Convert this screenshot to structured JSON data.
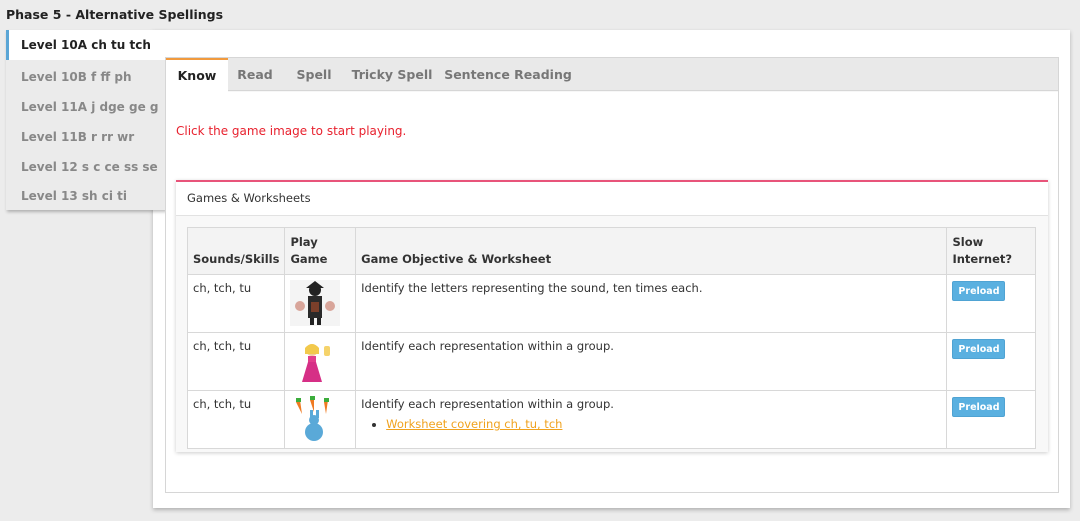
{
  "phase_title": "Phase 5 - Alternative Spellings",
  "levels": [
    {
      "label": "Level 10A ch tu tch",
      "active": true
    },
    {
      "label": "Level 10B f ff ph",
      "active": false
    },
    {
      "label": "Level 11A j dge ge g",
      "active": false
    },
    {
      "label": "Level 11B r rr wr",
      "active": false
    },
    {
      "label": "Level 12 s c ce ss se",
      "active": false
    },
    {
      "label": "Level 13 sh ci ti",
      "active": false
    }
  ],
  "tabs": [
    {
      "label": "Know",
      "active": true
    },
    {
      "label": "Read",
      "active": false
    },
    {
      "label": "Spell",
      "active": false
    },
    {
      "label": "Tricky Spell",
      "active": false
    },
    {
      "label": "Sentence Reading",
      "active": false
    }
  ],
  "instruction": "Click the game image to start playing.",
  "games_panel": {
    "title": "Games & Worksheets",
    "columns": {
      "sounds": "Sounds/Skills",
      "play": "Play Game",
      "objective": "Game Objective & Worksheet",
      "slow": "Slow Internet?"
    },
    "rows": [
      {
        "sounds": "ch, tch, tu",
        "thumb_icon": "witch-cauldron-game-icon",
        "objective": "Identify the letters representing the sound, ten times each.",
        "preload": "Preload"
      },
      {
        "sounds": "ch, tch, tu",
        "thumb_icon": "princess-game-icon",
        "objective": "Identify each representation within a group.",
        "preload": "Preload"
      },
      {
        "sounds": "ch, tch, tu",
        "thumb_icon": "bunny-carrots-game-icon",
        "objective": "Identify each representation within a group.",
        "worksheet": "Worksheet covering ch, tu, tch",
        "preload": "Preload"
      }
    ]
  },
  "colors": {
    "accent_tab": "#f19a3e",
    "panel_accent": "#e8547a",
    "instruction_text": "#e8212e",
    "preload_button": "#5ab0e0",
    "worksheet_link": "#f0a21e"
  }
}
